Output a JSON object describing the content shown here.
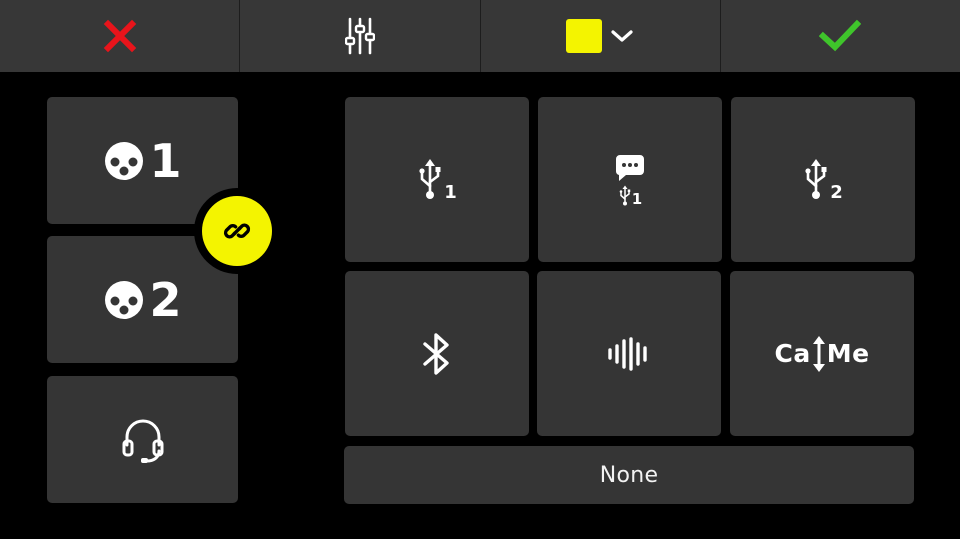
{
  "colors": {
    "toolbar_bg": "#373737",
    "tile_bg": "#353535",
    "accent_yellow": "#f4f400",
    "cancel_red": "#e8141b",
    "confirm_green": "#3fc52b",
    "link_icon": "#000000"
  },
  "toolbar": {
    "cancel": {
      "icon": "close-icon"
    },
    "mixer": {
      "icon": "sliders-icon"
    },
    "color": {
      "icon": "chevron-down-icon",
      "selected_color": "#f4f400"
    },
    "confirm": {
      "icon": "check-icon"
    }
  },
  "inputs": {
    "mic1": {
      "icon": "mic-capsule-icon",
      "number": "1"
    },
    "mic2": {
      "icon": "mic-capsule-icon",
      "number": "2"
    },
    "headset": {
      "icon": "headset-icon"
    },
    "link": {
      "icon": "link-icon"
    }
  },
  "outputs": {
    "usb1": {
      "icon": "usb-icon",
      "subscript": "1"
    },
    "usb1_chat": {
      "icon": "chat-bubble-icon",
      "subscript": "1"
    },
    "usb2": {
      "icon": "usb-icon",
      "subscript": "2"
    },
    "bluetooth": {
      "icon": "bluetooth-icon"
    },
    "audio": {
      "icon": "waveform-icon"
    },
    "callme": {
      "icon": "call-me-icon",
      "text_left": "Ca",
      "text_right": "Me"
    },
    "none": {
      "label": "None"
    }
  }
}
